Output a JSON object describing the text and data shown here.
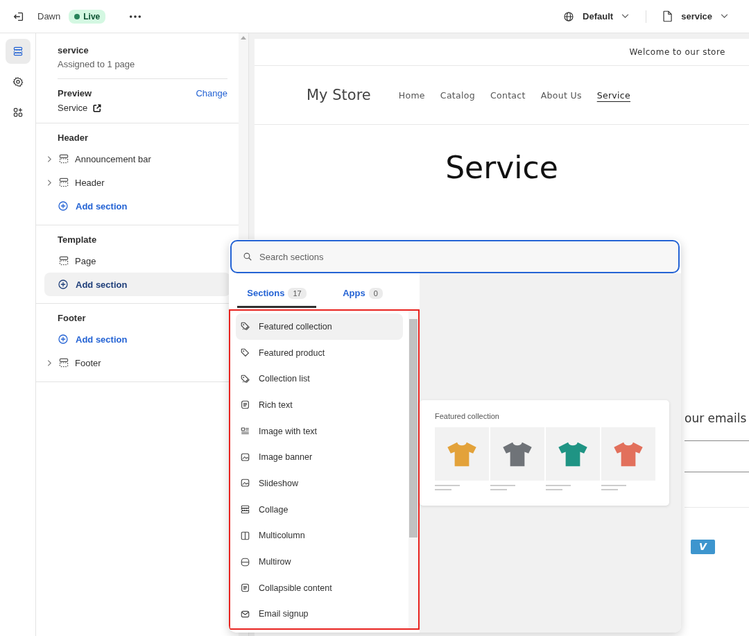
{
  "topbar": {
    "theme_name": "Dawn",
    "status": "Live",
    "language": "Default",
    "template": "service"
  },
  "rail_items": [
    {
      "selected": true
    },
    {
      "selected": false
    },
    {
      "selected": false
    }
  ],
  "sidebar": {
    "template_name": "service",
    "assigned": "Assigned to 1 page",
    "preview_label": "Preview",
    "preview_change": "Change",
    "preview_page": "Service",
    "groups": [
      {
        "title": "Header",
        "items": [
          {
            "kind": "section",
            "label": "Announcement bar",
            "expandable": true
          },
          {
            "kind": "section",
            "label": "Header",
            "expandable": true
          },
          {
            "kind": "add",
            "label": "Add section",
            "highlighted": false
          }
        ]
      },
      {
        "title": "Template",
        "items": [
          {
            "kind": "section",
            "label": "Page",
            "expandable": false
          },
          {
            "kind": "add",
            "label": "Add section",
            "highlighted": true
          }
        ]
      },
      {
        "title": "Footer",
        "items": [
          {
            "kind": "add",
            "label": "Add section",
            "highlighted": false
          },
          {
            "kind": "section",
            "label": "Footer",
            "expandable": true
          }
        ]
      }
    ]
  },
  "store": {
    "announcement": "Welcome to our store",
    "name": "My Store",
    "nav": [
      {
        "label": "Home",
        "selected": false
      },
      {
        "label": "Catalog",
        "selected": false
      },
      {
        "label": "Contact",
        "selected": false
      },
      {
        "label": "About Us",
        "selected": false
      },
      {
        "label": "Service",
        "selected": true
      }
    ],
    "page_title": "Service",
    "newsletter_text": "our emails",
    "payment_badge": "V"
  },
  "picker": {
    "search_placeholder": "Search sections",
    "tabs": [
      {
        "label": "Sections",
        "count": "17",
        "selected": true
      },
      {
        "label": "Apps",
        "count": "0",
        "selected": false
      }
    ],
    "sections": [
      {
        "label": "Featured collection",
        "selected": true
      },
      {
        "label": "Featured product",
        "selected": false
      },
      {
        "label": "Collection list",
        "selected": false
      },
      {
        "label": "Rich text",
        "selected": false
      },
      {
        "label": "Image with text",
        "selected": false
      },
      {
        "label": "Image banner",
        "selected": false
      },
      {
        "label": "Slideshow",
        "selected": false
      },
      {
        "label": "Collage",
        "selected": false
      },
      {
        "label": "Multicolumn",
        "selected": false
      },
      {
        "label": "Multirow",
        "selected": false
      },
      {
        "label": "Collapsible content",
        "selected": false
      },
      {
        "label": "Email signup",
        "selected": false
      }
    ],
    "preview": {
      "title": "Featured collection",
      "products": [
        {
          "color": "#e3a23a"
        },
        {
          "color": "#6f7378"
        },
        {
          "color": "#1f9484"
        },
        {
          "color": "#e2705c"
        }
      ]
    }
  }
}
